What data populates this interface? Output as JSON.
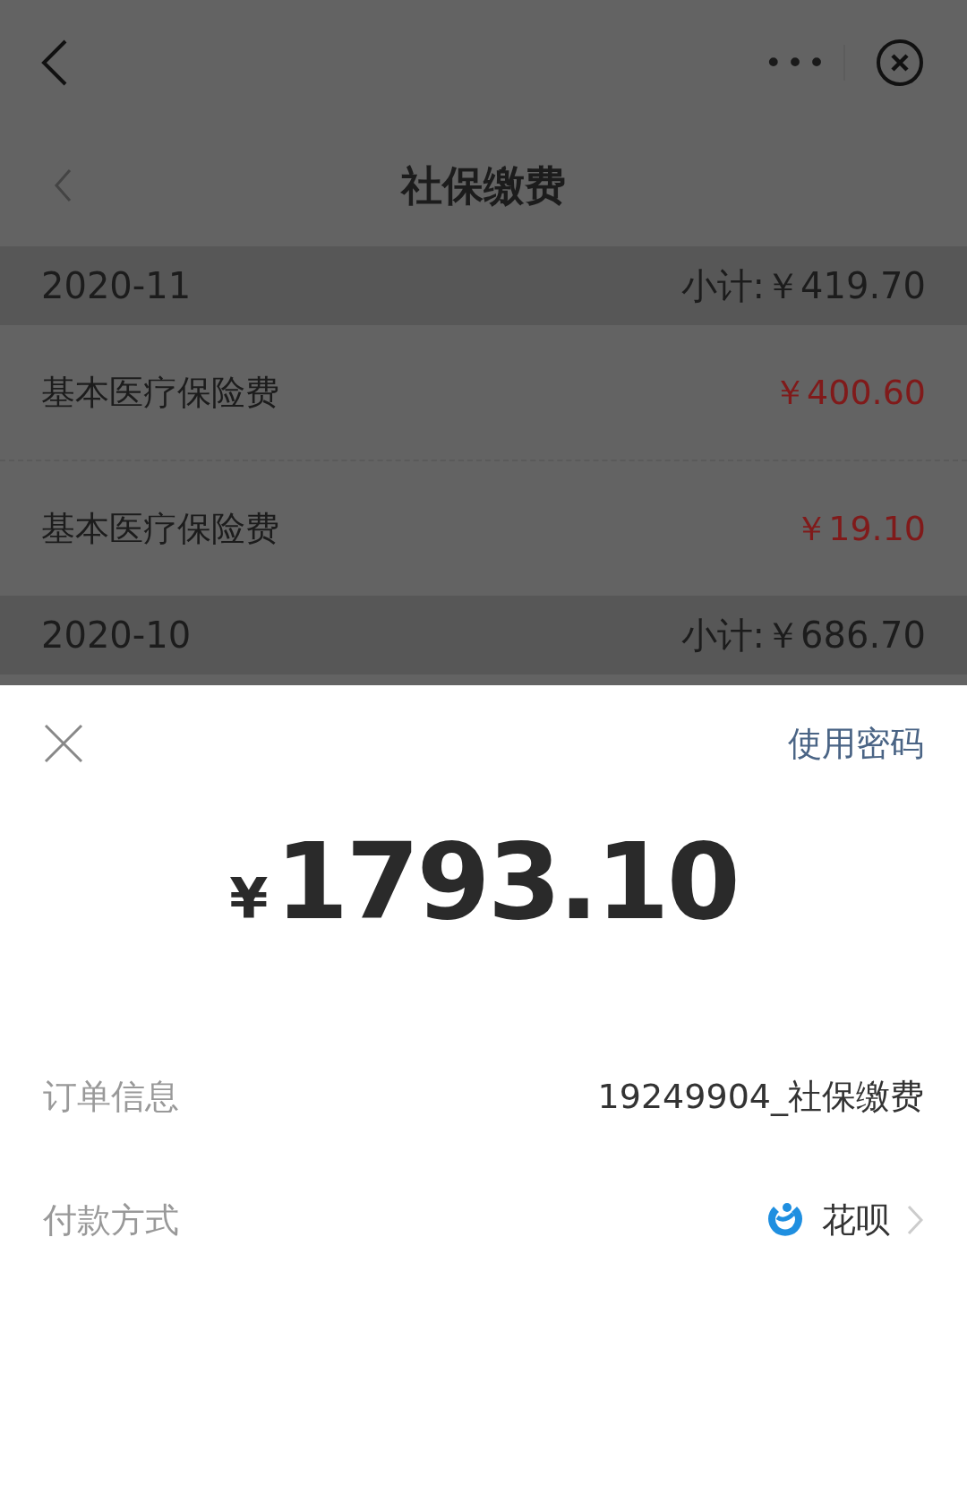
{
  "top_bar": {
    "more": "•••"
  },
  "header": {
    "title": "社保缴费"
  },
  "rows": [
    {
      "kind": "month",
      "label": "2020-11",
      "amount": "小计:￥419.70"
    },
    {
      "kind": "item",
      "label": "基本医疗保险费",
      "amount": "￥400.60"
    },
    {
      "kind": "item",
      "label": "基本医疗保险费",
      "amount": "￥19.10"
    },
    {
      "kind": "month",
      "label": "2020-10",
      "amount": "小计:￥686.70"
    }
  ],
  "payment_sheet": {
    "use_password": "使用密码",
    "currency": "¥",
    "amount": "1793.10",
    "details": [
      {
        "kind": "order",
        "label": "订单信息",
        "value": "19249904_社保缴费"
      },
      {
        "kind": "method",
        "label": "付款方式",
        "value": "花呗"
      }
    ]
  }
}
